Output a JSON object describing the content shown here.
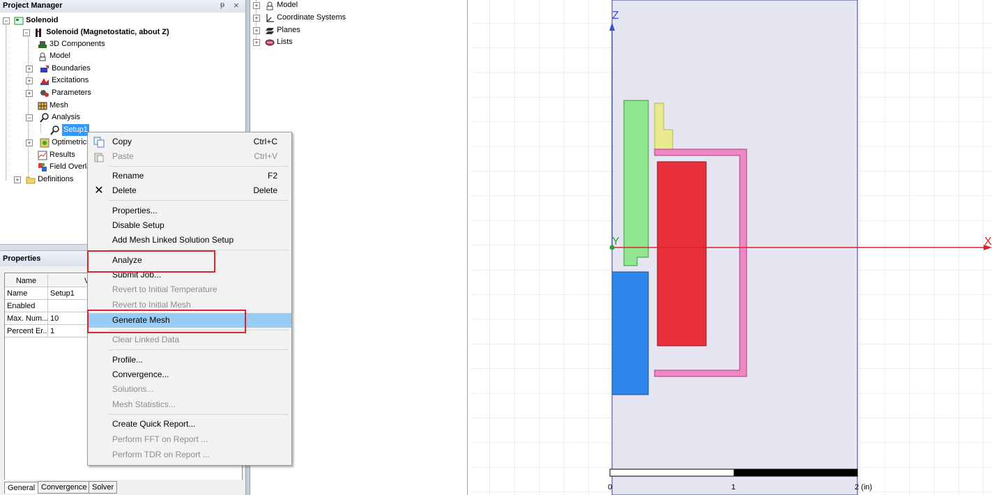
{
  "project_manager": {
    "title": "Project Manager",
    "pin_glyph": "ᵽ",
    "close_glyph": "×",
    "tree": {
      "project": "Solenoid",
      "design": "Solenoid (Magnetostatic, about Z)",
      "items": [
        "3D Components",
        "Model",
        "Boundaries",
        "Excitations",
        "Parameters",
        "Mesh",
        "Analysis"
      ],
      "setup": "Setup1",
      "after_setup": [
        "Optimetrics",
        "Results",
        "Field Overla"
      ],
      "definitions": "Definitions"
    }
  },
  "model_tree": {
    "items": [
      "Model",
      "Coordinate Systems",
      "Planes",
      "Lists"
    ]
  },
  "properties": {
    "title": "Properties",
    "col_name": "Name",
    "col_value": "V",
    "rows": [
      {
        "name": "Name",
        "value": "Setup1"
      },
      {
        "name": "Enabled",
        "value": ""
      },
      {
        "name": "Max. Num...",
        "value": "10"
      },
      {
        "name": "Percent Er...",
        "value": "1"
      }
    ],
    "tabs": [
      "General",
      "Convergence",
      "Solver"
    ]
  },
  "context_menu": {
    "items": [
      {
        "label": "Copy",
        "shortcut": "Ctrl+C",
        "icon": "copy-icon",
        "disabled": false
      },
      {
        "label": "Paste",
        "shortcut": "Ctrl+V",
        "icon": "paste-icon",
        "disabled": true
      },
      {
        "label": "Rename",
        "shortcut": "F2",
        "disabled": false
      },
      {
        "label": "Delete",
        "shortcut": "Delete",
        "icon": "delete-icon",
        "disabled": false
      },
      {
        "label": "Properties...",
        "disabled": false
      },
      {
        "label": "Disable Setup",
        "disabled": false
      },
      {
        "label": "Add Mesh Linked Solution Setup",
        "disabled": false
      },
      {
        "label": "Analyze",
        "disabled": false,
        "annotated": true
      },
      {
        "label": "Submit Job...",
        "disabled": false
      },
      {
        "label": "Revert to Initial Temperature",
        "disabled": true
      },
      {
        "label": "Revert to Initial Mesh",
        "disabled": true
      },
      {
        "label": "Generate Mesh",
        "disabled": false,
        "highlighted": true,
        "annotated": true
      },
      {
        "label": "Clear Linked Data",
        "disabled": true
      },
      {
        "label": "Profile...",
        "disabled": false
      },
      {
        "label": "Convergence...",
        "disabled": false
      },
      {
        "label": "Solutions...",
        "disabled": true
      },
      {
        "label": "Mesh Statistics...",
        "disabled": true
      },
      {
        "label": "Create Quick Report...",
        "disabled": false
      },
      {
        "label": "Perform FFT on Report ...",
        "disabled": true
      },
      {
        "label": "Perform TDR on Report ...",
        "disabled": true
      }
    ],
    "annotation_color": "#e1242c",
    "highlight_color": "#99ccf5"
  },
  "viewport": {
    "axis_labels": {
      "z": "Z",
      "x": "X",
      "y": "Y"
    },
    "scale_labels": [
      "0",
      "1",
      "2 (in)"
    ],
    "shapes": [
      {
        "name": "green-coil",
        "color": "#8ee68e"
      },
      {
        "name": "yellow-part",
        "color": "#e9e98f"
      },
      {
        "name": "pink-yoke",
        "color": "#ee88c4"
      },
      {
        "name": "red-core",
        "color": "#e8303c"
      },
      {
        "name": "blue-plunger",
        "color": "#2f86ea"
      }
    ],
    "region_color": "#e6e6f3"
  }
}
